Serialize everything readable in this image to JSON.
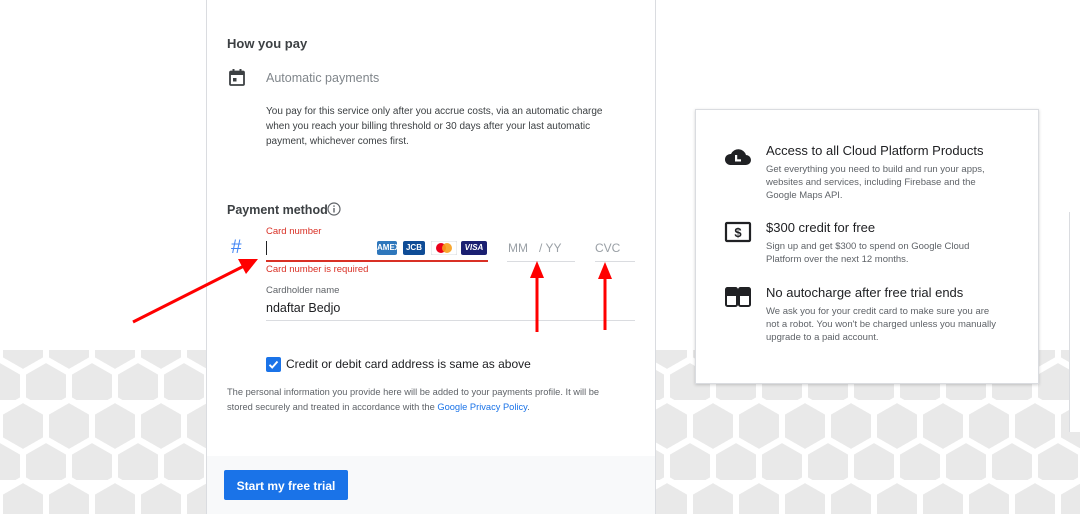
{
  "how_you_pay": {
    "title": "How you pay",
    "method_label": "Automatic payments",
    "method_icon": "calendar-icon",
    "description_lines": [
      "You pay for this service only after you accrue costs, via an automatic charge",
      "when you reach your billing threshold or 30 days after your last automatic",
      "payment, whichever comes first."
    ]
  },
  "payment_method": {
    "title": "Payment method",
    "info_icon": "info-icon",
    "card_icon": "#",
    "card_number": {
      "label": "Card number",
      "value": "",
      "error": "Card number is required",
      "brands": [
        "AMEX",
        "JCB",
        "MC",
        "VISA"
      ]
    },
    "expiry": {
      "month_placeholder": "MM",
      "year_placeholder": "/ YY"
    },
    "cvc": {
      "placeholder": "CVC"
    },
    "cardholder": {
      "label": "Cardholder name",
      "value": "ndaftar Bedjo"
    },
    "same_address": {
      "checked": true,
      "label": "Credit or debit card address is same as above"
    },
    "privacy": {
      "line1": "The personal information you provide here will be added to your payments profile. It will be",
      "line2_prefix": "stored securely and treated in accordance with the",
      "link": "Google Privacy Policy",
      "line2_suffix": "."
    }
  },
  "actions": {
    "start_trial": "Start my free trial"
  },
  "benefits": [
    {
      "icon": "cloud-icon",
      "title": "Access to all Cloud Platform Products",
      "desc_lines": [
        "Get everything you need to build and run your apps,",
        "websites and services, including Firebase and the",
        "Google Maps API."
      ]
    },
    {
      "icon": "dollar-icon",
      "title": "$300 credit for free",
      "desc_lines": [
        "Sign up and get $300 to spend on Google Cloud",
        "Platform over the next 12 months."
      ]
    },
    {
      "icon": "no-charge-icon",
      "title": "No autocharge after free trial ends",
      "desc_lines": [
        "We ask you for your credit card to make sure you are",
        "not a robot. You won't be charged unless you manually",
        "upgrade to a paid account."
      ]
    }
  ],
  "colors": {
    "accent": "#1a73e8",
    "error": "#d93025",
    "annotation_arrow": "#ff0000",
    "hex_pattern": "#e8e8e8"
  }
}
